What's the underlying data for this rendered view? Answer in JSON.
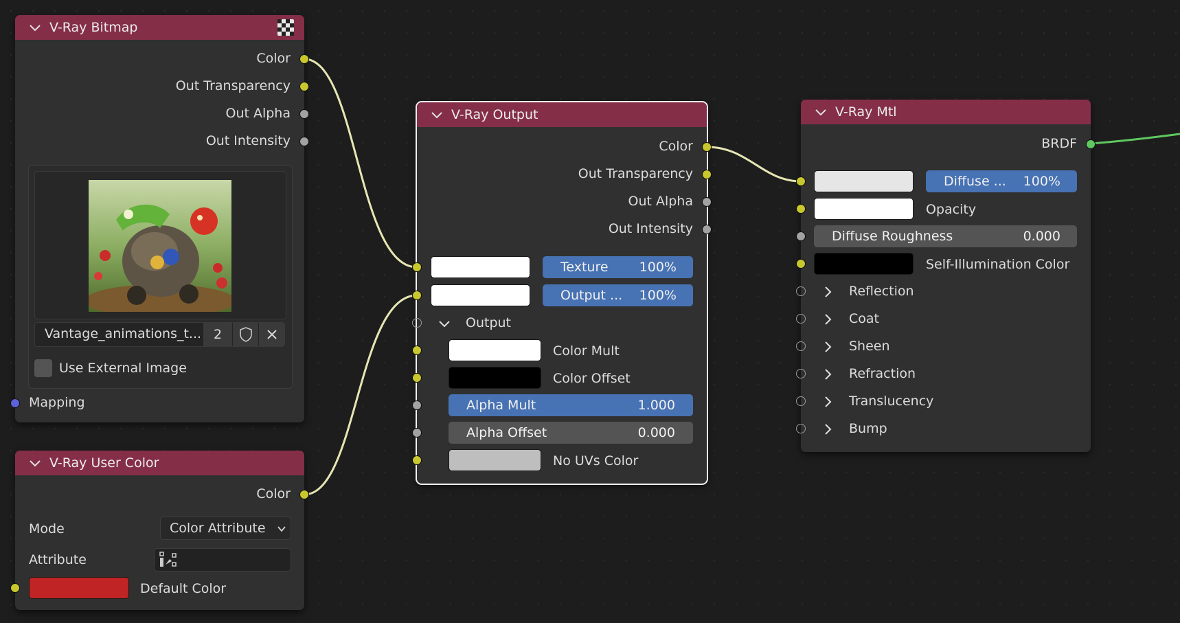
{
  "colors": {
    "header": "#852e48",
    "node_bg": "#303030",
    "socket_color": "#c8c82e",
    "socket_float": "#a2a2a2",
    "socket_vector": "#5c62d8",
    "socket_shader": "#5fc85f",
    "slider_blue": "#4772b3",
    "wire": "#e6e6b4",
    "wire_green": "#5fc85f",
    "default_color_swatch": "#c02424"
  },
  "bitmap": {
    "title": "V-Ray Bitmap",
    "header_icon": "checker-icon",
    "outputs": [
      "Color",
      "Out Transparency",
      "Out Alpha",
      "Out Intensity"
    ],
    "image_name": "Vantage_animations_t...",
    "user_count": "2",
    "use_external_label": "Use External Image",
    "mapping_label": "Mapping"
  },
  "user_color": {
    "title": "V-Ray User Color",
    "output": "Color",
    "mode_label": "Mode",
    "mode_value": "Color Attribute",
    "attribute_label": "Attribute",
    "attribute_value": "",
    "default_color_label": "Default Color"
  },
  "output_node": {
    "title": "V-Ray Output",
    "outputs": [
      "Color",
      "Out Transparency",
      "Out Alpha",
      "Out Intensity"
    ],
    "texture_label": "Texture",
    "texture_value": "100%",
    "output_label": "Output ...",
    "output_value": "100%",
    "panel_label": "Output",
    "color_mult_label": "Color Mult",
    "color_offset_label": "Color Offset",
    "alpha_mult_label": "Alpha Mult",
    "alpha_mult_value": "1.000",
    "alpha_offset_label": "Alpha Offset",
    "alpha_offset_value": "0.000",
    "no_uvs_label": "No UVs Color"
  },
  "mtl": {
    "title": "V-Ray Mtl",
    "output": "BRDF",
    "diffuse_label": "Diffuse ...",
    "diffuse_value": "100%",
    "opacity_label": "Opacity",
    "roughness_label": "Diffuse Roughness",
    "roughness_value": "0.000",
    "self_illum_label": "Self-Illumination Color",
    "panels": [
      "Reflection",
      "Coat",
      "Sheen",
      "Refraction",
      "Translucency",
      "Bump"
    ]
  }
}
